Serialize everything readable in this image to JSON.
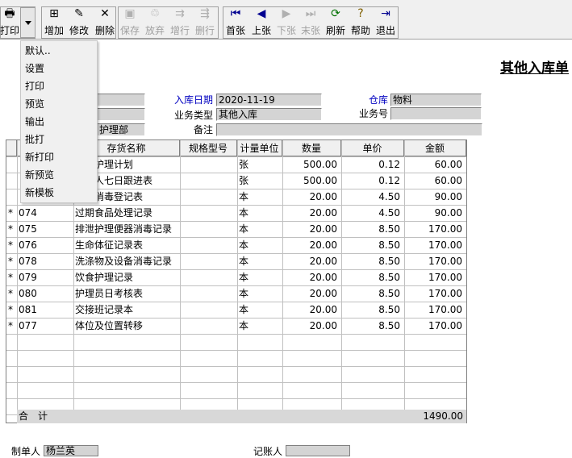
{
  "toolbar": {
    "print": "打印",
    "add": "增加",
    "edit": "修改",
    "delete": "删除",
    "save": "保存",
    "discard": "放弃",
    "add_row": "增行",
    "delete_row": "删行",
    "first": "首张",
    "prev": "上张",
    "next": "下张",
    "last": "末张",
    "refresh": "刷新",
    "help": "帮助",
    "exit": "退出"
  },
  "print_menu": [
    "默认..",
    "设置",
    "打印",
    "预览",
    "输出",
    "批打",
    "新打印",
    "新预览",
    "新模板"
  ],
  "title": "其他入库单",
  "header": {
    "date_label": "入库日期",
    "date_value": "2020-11-19",
    "warehouse_label": "仓库",
    "warehouse_value": "物料",
    "biz_type_label": "业务类型",
    "biz_type_value": "其他入库",
    "biz_no_label": "业务号",
    "biz_no_value": "",
    "remark_label": "备注",
    "remark_value": "",
    "dept_value": "护理部"
  },
  "table": {
    "columns": [
      "存货名称",
      "规格型号",
      "计量单位",
      "数量",
      "单价",
      "金额"
    ],
    "rows": [
      {
        "mark": "",
        "code": "",
        "name": "生活护理计划",
        "spec": "",
        "unit": "张",
        "qty": "500.00",
        "price": "0.12",
        "amount": "60.00"
      },
      {
        "mark": "",
        "code": "",
        "name": "住老人七日跟进表",
        "spec": "",
        "unit": "张",
        "qty": "500.00",
        "price": "0.12",
        "amount": "60.00"
      },
      {
        "mark": "",
        "code": "",
        "name": "终末消毒登记表",
        "spec": "",
        "unit": "本",
        "qty": "20.00",
        "price": "4.50",
        "amount": "90.00"
      },
      {
        "mark": "*",
        "code": "074",
        "name": "过期食品处理记录",
        "spec": "",
        "unit": "本",
        "qty": "20.00",
        "price": "4.50",
        "amount": "90.00"
      },
      {
        "mark": "*",
        "code": "075",
        "name": "排泄护理便器消毒记录",
        "spec": "",
        "unit": "本",
        "qty": "20.00",
        "price": "8.50",
        "amount": "170.00"
      },
      {
        "mark": "*",
        "code": "076",
        "name": "生命体征记录表",
        "spec": "",
        "unit": "本",
        "qty": "20.00",
        "price": "8.50",
        "amount": "170.00"
      },
      {
        "mark": "*",
        "code": "078",
        "name": "洗涤物及设备消毒记录",
        "spec": "",
        "unit": "本",
        "qty": "20.00",
        "price": "8.50",
        "amount": "170.00"
      },
      {
        "mark": "*",
        "code": "079",
        "name": "饮食护理记录",
        "spec": "",
        "unit": "本",
        "qty": "20.00",
        "price": "8.50",
        "amount": "170.00"
      },
      {
        "mark": "*",
        "code": "080",
        "name": "护理员日考核表",
        "spec": "",
        "unit": "本",
        "qty": "20.00",
        "price": "8.50",
        "amount": "170.00"
      },
      {
        "mark": "*",
        "code": "081",
        "name": "交接班记录本",
        "spec": "",
        "unit": "本",
        "qty": "20.00",
        "price": "8.50",
        "amount": "170.00"
      },
      {
        "mark": "*",
        "code": "077",
        "name": "体位及位置转移",
        "spec": "",
        "unit": "本",
        "qty": "20.00",
        "price": "8.50",
        "amount": "170.00"
      }
    ],
    "total_label": "合　计",
    "total_amount": "1490.00"
  },
  "footer": {
    "maker_label": "制单人",
    "maker_value": "杨兰英",
    "bookkeeper_label": "记账人",
    "bookkeeper_value": ""
  }
}
